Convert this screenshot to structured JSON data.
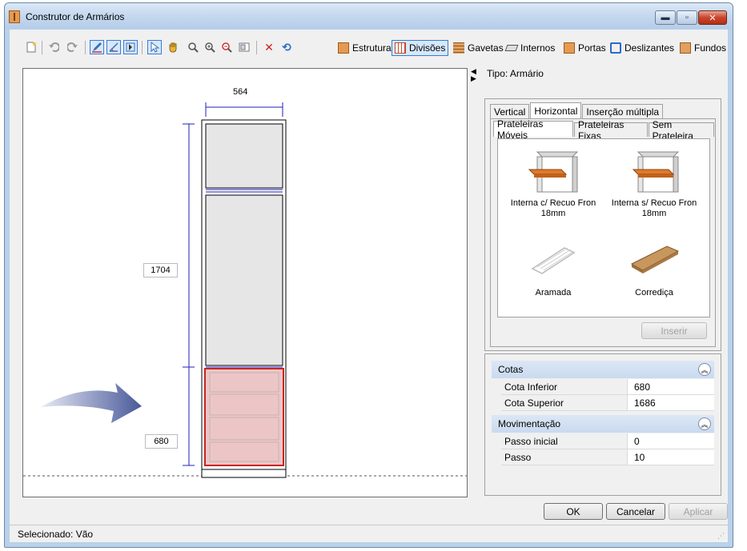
{
  "window": {
    "title": "Construtor de Armários",
    "min": "▬",
    "max": "▫",
    "close": "✕"
  },
  "toolbar": {
    "estrutura": "Estrutura",
    "divisoes": "Divisões",
    "gavetas": "Gavetas",
    "internos": "Internos",
    "portas": "Portas",
    "deslizantes": "Deslizantes",
    "fundos": "Fundos"
  },
  "canvas": {
    "width_dim": "564",
    "height_dim": "1704",
    "lower_dim": "680"
  },
  "panel": {
    "tipo": "Tipo: Armário",
    "tabs": [
      "Vertical",
      "Horizontal",
      "Inserção múltipla"
    ],
    "subtabs": [
      "Prateleiras Móveis",
      "Prateleiras Fixas",
      "Sem Prateleira"
    ],
    "items": [
      {
        "label": "Interna c/ Recuo Fron 18mm"
      },
      {
        "label": "Interna s/ Recuo Fron 18mm"
      },
      {
        "label": "Aramada"
      },
      {
        "label": "Corrediça"
      }
    ],
    "inserir": "Inserir"
  },
  "props": {
    "cotas": {
      "title": "Cotas",
      "rows": [
        {
          "k": "Cota Inferior",
          "v": "680"
        },
        {
          "k": "Cota Superior",
          "v": "1686"
        }
      ]
    },
    "mov": {
      "title": "Movimentação",
      "rows": [
        {
          "k": "Passo inicial",
          "v": "0"
        },
        {
          "k": "Passo",
          "v": "10"
        }
      ]
    }
  },
  "buttons": {
    "ok": "OK",
    "cancel": "Cancelar",
    "apply": "Aplicar"
  },
  "status": "Selecionado: Vão",
  "colors": {
    "dim_line": "#1f1fbd",
    "selection": "#c82424",
    "accent": "#3a7bd5"
  }
}
